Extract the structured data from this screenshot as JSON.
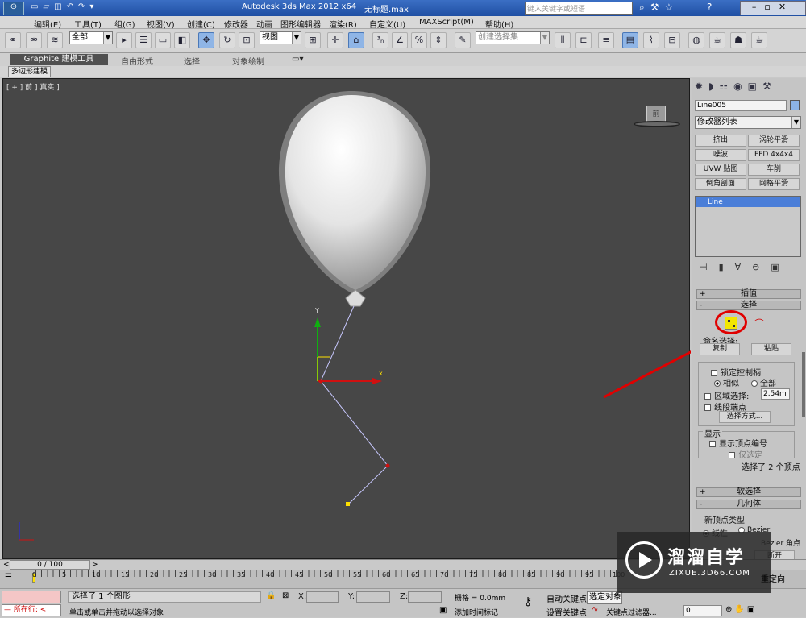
{
  "window": {
    "title_app": "Autodesk 3ds Max  2012 x64",
    "title_file": "无标题.max",
    "search_placeholder": "键入关键字或短语"
  },
  "menu": [
    "编辑(E)",
    "工具(T)",
    "组(G)",
    "视图(V)",
    "创建(C)",
    "修改器",
    "动画",
    "图形编辑器",
    "渲染(R)",
    "自定义(U)",
    "MAXScript(M)",
    "帮助(H)"
  ],
  "toolbar": {
    "selection_filter": "全部",
    "reference_coord": "视图",
    "named_selection": "创建选择集"
  },
  "ribbon": {
    "tabs": [
      "Graphite 建模工具",
      "自由形式",
      "选择",
      "对象绘制"
    ],
    "sub_label": "多边形建模"
  },
  "viewport": {
    "label": "[ + ] 前 ] 真实 ]",
    "viewcube_label": "前"
  },
  "command_panel": {
    "object_name": "Line005",
    "modifier_list": "修改器列表",
    "modifier_buttons": [
      "挤出",
      "涡轮平滑",
      "噪波",
      "FFD 4x4x4",
      "UVW 贴图",
      "车削",
      "倒角剖面",
      "网格平滑"
    ],
    "stack_item": "Line",
    "rollouts": {
      "interpolation": "插值",
      "selection": "选择",
      "named_selection_label": "命名选择:",
      "copy": "复制",
      "paste": "粘贴",
      "lock_handles": "锁定控制柄",
      "similar": "相似",
      "all": "全部",
      "area_selection": "区域选择:",
      "area_value": "2.54m",
      "segment_end": "线段端点",
      "select_by": "选择方式...",
      "display": "显示",
      "show_vertex_numbers": "显示顶点编号",
      "selected_only": "仅选定",
      "status": "选择了 2 个顶点",
      "soft_selection": "软选择",
      "geometry": "几何体",
      "new_vertex_type": "新顶点类型",
      "linear": "线性",
      "bezier": "Bezier",
      "bezier_corner": "Bezier 角点",
      "break": "断开",
      "reorient": "重定向"
    }
  },
  "timeline": {
    "frame_display": "0 / 100",
    "ticks": [
      "0",
      "5",
      "10",
      "15",
      "20",
      "25",
      "30",
      "35",
      "40",
      "45",
      "50",
      "55",
      "60",
      "65",
      "70",
      "75",
      "80",
      "85",
      "90",
      "95",
      "100"
    ]
  },
  "status": {
    "maxscript_label": "所在行:",
    "prompt": "选择了 1 个图形",
    "hint": "单击或单击并拖动以选择对象",
    "x_label": "X:",
    "y_label": "Y:",
    "z_label": "Z:",
    "grid": "栅格 = 0.0mm",
    "add_time_tag": "添加时间标记",
    "auto_key": "自动关键点",
    "set_key": "设置关键点",
    "key_mode": "选定对象",
    "key_filters": "关键点过滤器...",
    "frame": "0"
  },
  "watermark": {
    "text": "溜溜自学",
    "url": "ZIXUE.3D66.COM"
  }
}
